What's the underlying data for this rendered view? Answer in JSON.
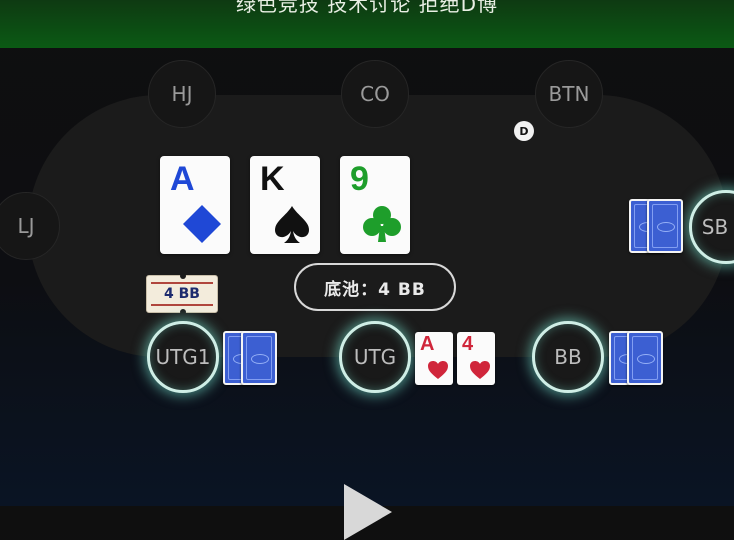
{
  "banner": {
    "text": "绿色竞技   技术讨论   拒绝D博"
  },
  "seats": {
    "hj": "HJ",
    "co": "CO",
    "btn": "BTN",
    "lj": "LJ",
    "sb": "SB",
    "utg1": "UTG1",
    "utg": "UTG",
    "bb": "BB"
  },
  "dealer_button": "D",
  "board": [
    {
      "rank": "A",
      "suit": "diamond",
      "color": "#1f48d6"
    },
    {
      "rank": "K",
      "suit": "spade",
      "color": "#111111"
    },
    {
      "rank": "9",
      "suit": "club",
      "color": "#1e9e2b"
    }
  ],
  "pot": {
    "label": "底池：4 BB"
  },
  "bet": {
    "amount": "4 BB",
    "seat": "UTG1"
  },
  "hero_hand": [
    {
      "rank": "A",
      "suit": "heart",
      "color": "#d0263b"
    },
    {
      "rank": "4",
      "suit": "heart",
      "color": "#d0263b"
    }
  ],
  "colors": {
    "table": "#1b1b1b",
    "banner": "#0b5a14",
    "card_back": "#3c5fd2",
    "seat_glow": "#7fe6d2"
  }
}
